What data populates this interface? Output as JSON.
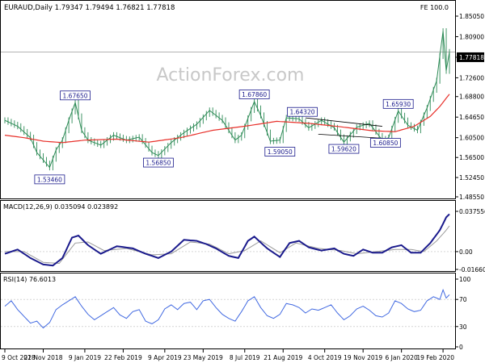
{
  "header": {
    "symbol_line": "EURAUD,Daily  1.79347 1.79494 1.76821 1.77818",
    "fe_label": "FE 100.0"
  },
  "watermark": "ActionForex.com",
  "colors": {
    "price": "#2e8b57",
    "ma": "#e8302a",
    "macd": "#1a1a8c",
    "signal": "#9a9a9a",
    "rsi": "#4169e1",
    "label_border": "#1a1a8c",
    "label_text": "#1a1a8c",
    "watermark": "#c8c8c8"
  },
  "chart_data": [
    {
      "type": "line",
      "panel": "price",
      "title": "EURAUD,Daily",
      "last_price": "1.77818",
      "ylim": [
        1.4855,
        1.8505
      ],
      "yticks": [
        1.8505,
        1.809,
        1.7675,
        1.726,
        1.688,
        1.6465,
        1.605,
        1.565,
        1.5245,
        1.4855
      ],
      "ytick_labels": [
        "1.85050",
        "1.80900",
        "1.77818",
        "1.72600",
        "1.68800",
        "1.64650",
        "1.60500",
        "1.56500",
        "1.52450",
        "1.48550"
      ],
      "x_labels": [
        "9 Oct 2018",
        "22 Nov 2018",
        "9 Jan 2019",
        "22 Feb 2019",
        "9 Apr 2019",
        "23 May 2019",
        "8 Jul 2019",
        "21 Aug 2019",
        "4 Oct 2019",
        "19 Nov 2019",
        "6 Jan 2020",
        "19 Feb 2020"
      ],
      "x_count": 140,
      "price_anchors": [
        [
          0,
          1.64
        ],
        [
          4,
          1.628
        ],
        [
          8,
          1.605
        ],
        [
          10,
          1.575
        ],
        [
          12,
          1.56
        ],
        [
          14,
          1.545
        ],
        [
          16,
          1.58
        ],
        [
          18,
          1.6
        ],
        [
          20,
          1.64
        ],
        [
          22,
          1.676
        ],
        [
          24,
          1.62
        ],
        [
          26,
          1.6
        ],
        [
          30,
          1.59
        ],
        [
          34,
          1.61
        ],
        [
          38,
          1.6
        ],
        [
          42,
          1.606
        ],
        [
          46,
          1.575
        ],
        [
          48,
          1.569
        ],
        [
          52,
          1.595
        ],
        [
          56,
          1.615
        ],
        [
          60,
          1.632
        ],
        [
          64,
          1.66
        ],
        [
          68,
          1.64
        ],
        [
          72,
          1.6
        ],
        [
          74,
          1.61
        ],
        [
          78,
          1.678
        ],
        [
          80,
          1.65
        ],
        [
          83,
          1.598
        ],
        [
          86,
          1.6
        ],
        [
          88,
          1.645
        ],
        [
          92,
          1.643
        ],
        [
          95,
          1.625
        ],
        [
          99,
          1.64
        ],
        [
          103,
          1.625
        ],
        [
          106,
          1.596
        ],
        [
          110,
          1.626
        ],
        [
          114,
          1.634
        ],
        [
          118,
          1.6
        ],
        [
          120,
          1.605
        ],
        [
          123,
          1.659
        ],
        [
          126,
          1.63
        ],
        [
          129,
          1.62
        ],
        [
          132,
          1.665
        ],
        [
          135,
          1.72
        ],
        [
          137,
          1.82
        ],
        [
          138,
          1.74
        ],
        [
          139,
          1.778
        ]
      ],
      "ma_anchors": [
        [
          0,
          1.61
        ],
        [
          6,
          1.605
        ],
        [
          12,
          1.598
        ],
        [
          18,
          1.595
        ],
        [
          25,
          1.6
        ],
        [
          35,
          1.602
        ],
        [
          45,
          1.596
        ],
        [
          55,
          1.605
        ],
        [
          65,
          1.62
        ],
        [
          75,
          1.628
        ],
        [
          85,
          1.638
        ],
        [
          95,
          1.634
        ],
        [
          105,
          1.627
        ],
        [
          115,
          1.619
        ],
        [
          122,
          1.617
        ],
        [
          128,
          1.628
        ],
        [
          133,
          1.648
        ],
        [
          136,
          1.668
        ],
        [
          139,
          1.693
        ]
      ],
      "labels": [
        {
          "text": "1.67650",
          "x": 22,
          "price": 1.6765,
          "pos": "above"
        },
        {
          "text": "1.53460",
          "x": 14,
          "price": 1.5346,
          "pos": "below"
        },
        {
          "text": "1.56850",
          "x": 48,
          "price": 1.5685,
          "pos": "below"
        },
        {
          "text": "1.67860",
          "x": 78,
          "price": 1.6786,
          "pos": "above"
        },
        {
          "text": "1.59050",
          "x": 86,
          "price": 1.5905,
          "pos": "below"
        },
        {
          "text": "1.64320",
          "x": 93,
          "price": 1.6432,
          "pos": "above"
        },
        {
          "text": "1.59620",
          "x": 106,
          "price": 1.5962,
          "pos": "below"
        },
        {
          "text": "1.60850",
          "x": 119,
          "price": 1.6085,
          "pos": "below"
        },
        {
          "text": "1.65930",
          "x": 123,
          "price": 1.6593,
          "pos": "above"
        }
      ],
      "trendlines": [
        [
          [
            94,
            1.645
          ],
          [
            118,
            1.628
          ]
        ],
        [
          [
            98,
            1.612
          ],
          [
            120,
            1.603
          ]
        ]
      ]
    },
    {
      "type": "line",
      "panel": "macd",
      "title": "MACD(12,26,9) 0.035094 0.023892",
      "ylim": [
        -0.016606,
        0.037556
      ],
      "ytick_labels": [
        "0.037556",
        "0.00",
        "-0.016606"
      ],
      "macd_anchors": [
        [
          0,
          -0.002
        ],
        [
          4,
          0.002
        ],
        [
          8,
          -0.006
        ],
        [
          12,
          -0.012
        ],
        [
          15,
          -0.013
        ],
        [
          18,
          -0.006
        ],
        [
          21,
          0.013
        ],
        [
          23,
          0.015
        ],
        [
          26,
          0.006
        ],
        [
          30,
          -0.002
        ],
        [
          35,
          0.005
        ],
        [
          40,
          0.003
        ],
        [
          44,
          -0.002
        ],
        [
          48,
          -0.006
        ],
        [
          52,
          0.0
        ],
        [
          56,
          0.011
        ],
        [
          60,
          0.01
        ],
        [
          63,
          0.007
        ],
        [
          66,
          0.003
        ],
        [
          70,
          -0.004
        ],
        [
          73,
          -0.006
        ],
        [
          76,
          0.01
        ],
        [
          78,
          0.014
        ],
        [
          82,
          0.003
        ],
        [
          86,
          -0.005
        ],
        [
          89,
          0.008
        ],
        [
          92,
          0.01
        ],
        [
          95,
          0.004
        ],
        [
          99,
          0.001
        ],
        [
          103,
          0.003
        ],
        [
          106,
          -0.002
        ],
        [
          109,
          -0.004
        ],
        [
          112,
          0.002
        ],
        [
          115,
          -0.001
        ],
        [
          118,
          -0.001
        ],
        [
          121,
          0.004
        ],
        [
          124,
          0.006
        ],
        [
          127,
          -0.001
        ],
        [
          130,
          -0.001
        ],
        [
          133,
          0.008
        ],
        [
          136,
          0.02
        ],
        [
          138,
          0.032
        ],
        [
          139,
          0.035
        ]
      ],
      "signal_anchors": [
        [
          0,
          0.0
        ],
        [
          6,
          0.0
        ],
        [
          12,
          -0.01
        ],
        [
          17,
          -0.011
        ],
        [
          22,
          0.008
        ],
        [
          26,
          0.009
        ],
        [
          31,
          0.001
        ],
        [
          38,
          0.003
        ],
        [
          46,
          -0.003
        ],
        [
          52,
          -0.002
        ],
        [
          58,
          0.009
        ],
        [
          64,
          0.007
        ],
        [
          70,
          -0.002
        ],
        [
          75,
          0.001
        ],
        [
          80,
          0.01
        ],
        [
          86,
          -0.001
        ],
        [
          91,
          0.008
        ],
        [
          98,
          0.003
        ],
        [
          105,
          0.001
        ],
        [
          110,
          -0.002
        ],
        [
          116,
          0.0
        ],
        [
          122,
          0.002
        ],
        [
          127,
          0.002
        ],
        [
          131,
          0.0
        ],
        [
          135,
          0.01
        ],
        [
          138,
          0.02
        ],
        [
          139,
          0.024
        ]
      ]
    },
    {
      "type": "line",
      "panel": "rsi",
      "title": "RSI(14) 76.6013",
      "ylim": [
        0,
        100
      ],
      "ytick_labels": [
        "100",
        "70",
        "30",
        "0"
      ],
      "rsi_anchors": [
        [
          0,
          60
        ],
        [
          2,
          68
        ],
        [
          4,
          55
        ],
        [
          6,
          45
        ],
        [
          8,
          35
        ],
        [
          10,
          38
        ],
        [
          12,
          28
        ],
        [
          14,
          36
        ],
        [
          16,
          55
        ],
        [
          18,
          62
        ],
        [
          20,
          68
        ],
        [
          22,
          74
        ],
        [
          24,
          60
        ],
        [
          26,
          48
        ],
        [
          28,
          40
        ],
        [
          30,
          46
        ],
        [
          32,
          52
        ],
        [
          34,
          58
        ],
        [
          36,
          47
        ],
        [
          38,
          42
        ],
        [
          40,
          52
        ],
        [
          42,
          55
        ],
        [
          44,
          38
        ],
        [
          46,
          34
        ],
        [
          48,
          40
        ],
        [
          50,
          56
        ],
        [
          52,
          62
        ],
        [
          54,
          55
        ],
        [
          56,
          64
        ],
        [
          58,
          66
        ],
        [
          60,
          55
        ],
        [
          62,
          68
        ],
        [
          64,
          70
        ],
        [
          66,
          58
        ],
        [
          68,
          48
        ],
        [
          70,
          42
        ],
        [
          72,
          38
        ],
        [
          74,
          52
        ],
        [
          76,
          68
        ],
        [
          78,
          74
        ],
        [
          80,
          58
        ],
        [
          82,
          46
        ],
        [
          84,
          42
        ],
        [
          86,
          48
        ],
        [
          88,
          64
        ],
        [
          90,
          62
        ],
        [
          92,
          58
        ],
        [
          94,
          50
        ],
        [
          96,
          56
        ],
        [
          98,
          54
        ],
        [
          100,
          58
        ],
        [
          102,
          62
        ],
        [
          104,
          50
        ],
        [
          106,
          40
        ],
        [
          108,
          46
        ],
        [
          110,
          56
        ],
        [
          112,
          60
        ],
        [
          114,
          54
        ],
        [
          116,
          46
        ],
        [
          118,
          44
        ],
        [
          120,
          50
        ],
        [
          122,
          68
        ],
        [
          124,
          64
        ],
        [
          126,
          56
        ],
        [
          128,
          52
        ],
        [
          130,
          54
        ],
        [
          132,
          68
        ],
        [
          134,
          74
        ],
        [
          136,
          70
        ],
        [
          137,
          84
        ],
        [
          138,
          72
        ],
        [
          139,
          77
        ]
      ]
    }
  ]
}
